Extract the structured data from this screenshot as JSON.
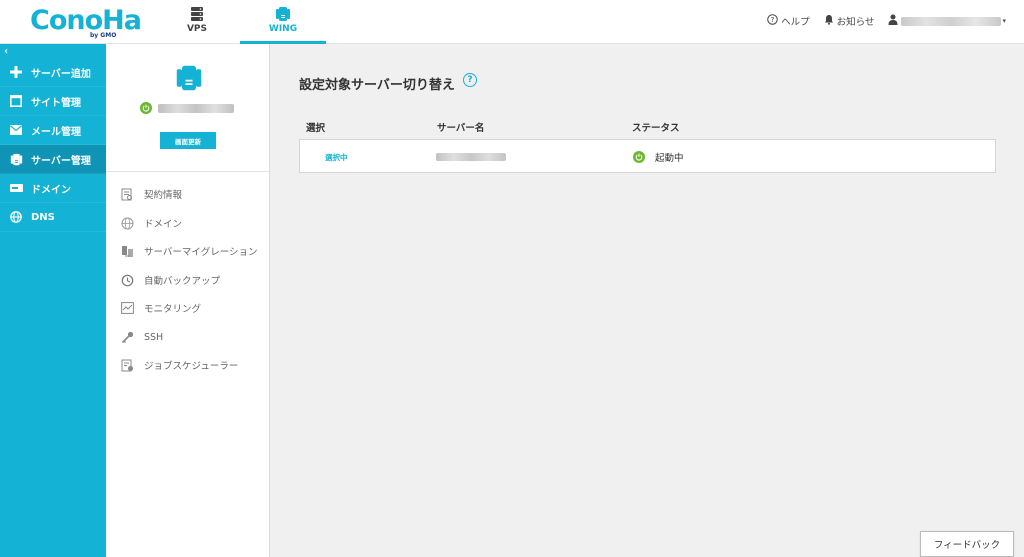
{
  "brand": {
    "logo": "ConoHa",
    "logo_sub": "by GMO",
    "accent": "#14b3d6",
    "sidebar_active": "#0f94b5",
    "status_green": "#6ab82c"
  },
  "header": {
    "tabs": [
      {
        "label": "VPS",
        "icon": "server-stack-icon",
        "active": false
      },
      {
        "label": "WING",
        "icon": "wing-server-icon",
        "active": true
      }
    ],
    "help_label": "ヘルプ",
    "notice_label": "お知らせ"
  },
  "sidebar": {
    "collapse": "‹",
    "items": [
      {
        "label": "サーバー追加",
        "icon": "plus-icon",
        "active": false
      },
      {
        "label": "サイト管理",
        "icon": "window-icon",
        "active": false
      },
      {
        "label": "メール管理",
        "icon": "mail-icon",
        "active": false
      },
      {
        "label": "サーバー管理",
        "icon": "server-icon",
        "active": true
      },
      {
        "label": "ドメイン",
        "icon": "domain-icon",
        "active": false
      },
      {
        "label": "DNS",
        "icon": "globe-icon",
        "active": false
      }
    ]
  },
  "subpanel": {
    "refresh_label": "画面更新",
    "items": [
      {
        "label": "契約情報",
        "icon": "contract-icon"
      },
      {
        "label": "ドメイン",
        "icon": "www-globe-icon"
      },
      {
        "label": "サーバーマイグレーション",
        "icon": "migration-icon"
      },
      {
        "label": "自動バックアップ",
        "icon": "backup-clock-icon"
      },
      {
        "label": "モニタリング",
        "icon": "monitoring-icon"
      },
      {
        "label": "SSH",
        "icon": "key-icon"
      },
      {
        "label": "ジョブスケジューラー",
        "icon": "scheduler-icon"
      }
    ]
  },
  "main": {
    "title": "設定対象サーバー切り替え",
    "help": "?",
    "columns": [
      "選択",
      "サーバー名",
      "ステータス"
    ],
    "rows": [
      {
        "select": "選択中",
        "status": "起動中"
      }
    ],
    "feedback_label": "フィードバック"
  }
}
